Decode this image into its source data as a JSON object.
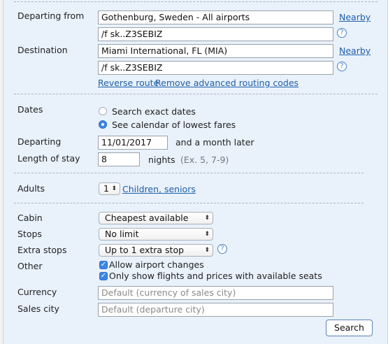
{
  "departing_from": {
    "label": "Departing from",
    "value": "Gothenburg, Sweden - All airports",
    "routing_code": "/f sk..Z3SEBIZ",
    "nearby_link": "Nearby",
    "help_icon": "?"
  },
  "destination": {
    "label": "Destination",
    "value": "Miami International, FL (MIA)",
    "routing_code": "/f sk..Z3SEBIZ",
    "nearby_link": "Nearby",
    "help_icon": "?"
  },
  "route_links": {
    "reverse": "Reverse route",
    "remove_codes": "Remove advanced routing codes"
  },
  "dates": {
    "label": "Dates",
    "option_exact": "Search exact dates",
    "option_calendar": "See calendar of lowest fares",
    "selected": "option_calendar"
  },
  "departing": {
    "label": "Departing",
    "value": "11/01/2017",
    "suffix": "and a month later"
  },
  "length_of_stay": {
    "label": "Length of stay",
    "value": "8",
    "unit": "nights",
    "hint": "(Ex. 5, 7-9)"
  },
  "adults": {
    "label": "Adults",
    "value": "1",
    "link": "Children, seniors"
  },
  "cabin": {
    "label": "Cabin",
    "value": "Cheapest available"
  },
  "stops": {
    "label": "Stops",
    "value": "No limit"
  },
  "extra_stops": {
    "label": "Extra stops",
    "value": "Up to 1 extra stop",
    "help_icon": "?"
  },
  "other": {
    "label": "Other",
    "option_airport_changes": "Allow airport changes",
    "option_available_seats": "Only show flights and prices with available seats",
    "checked": [
      true,
      true
    ]
  },
  "currency": {
    "label": "Currency",
    "placeholder": "Default (currency of sales city)"
  },
  "sales_city": {
    "label": "Sales city",
    "placeholder": "Default (departure city)"
  },
  "search_button": "Search",
  "icons": {
    "select_arrows": "up-down-chevrons",
    "help": "question-circle-icon",
    "check": "checkmark-icon"
  },
  "colors": {
    "link": "#1f5fa8",
    "accent": "#3b86e8",
    "panel_bg": "#e9f1fb"
  }
}
